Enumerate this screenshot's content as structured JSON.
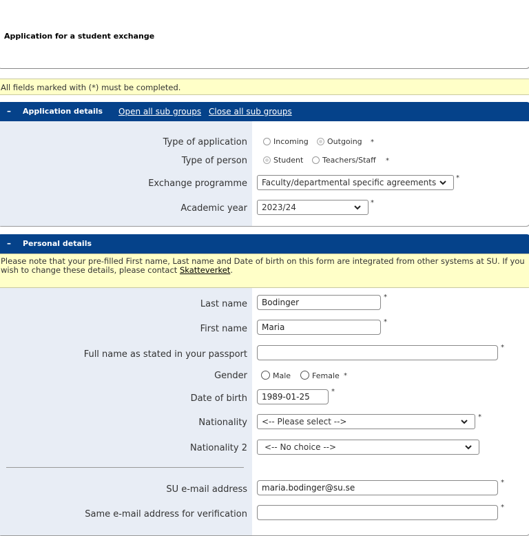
{
  "page": {
    "title": "Application for a student exchange"
  },
  "notice_required": "All fields marked with (*) must be completed.",
  "application": {
    "header": "Application details",
    "open_all": "Open all sub groups",
    "close_all": "Close all sub groups",
    "type_of_application": {
      "label": "Type of application",
      "options": [
        "Incoming",
        "Outgoing"
      ],
      "selected": "Outgoing"
    },
    "type_of_person": {
      "label": "Type of person",
      "options": [
        "Student",
        "Teachers/Staff"
      ],
      "selected": "Student"
    },
    "exchange_programme": {
      "label": "Exchange programme",
      "value": "Faculty/departmental specific agreements"
    },
    "academic_year": {
      "label": "Academic year",
      "value": "2023/24"
    }
  },
  "personal": {
    "header": "Personal details",
    "notice_text": "Please note that your pre-filled First name, Last name and Date of birth on this form are integrated from other systems at SU. If you wish to change these details, please contact ",
    "notice_link": "Skatteverket",
    "notice_end": ".",
    "last_name": {
      "label": "Last name",
      "value": "Bodinger"
    },
    "first_name": {
      "label": "First name",
      "value": "Maria"
    },
    "passport_name": {
      "label": "Full name as stated in your passport",
      "value": ""
    },
    "gender": {
      "label": "Gender",
      "options": [
        "Male",
        "Female"
      ]
    },
    "dob": {
      "label": "Date of birth",
      "value": "1989-01-25"
    },
    "nationality": {
      "label": "Nationality",
      "value": "<-- Please select -->"
    },
    "nationality2": {
      "label": "Nationality 2",
      "value": "<-- No choice -->"
    },
    "su_email": {
      "label": "SU e-mail address",
      "value": "maria.bodinger@su.se"
    },
    "email_verify": {
      "label": "Same e-mail address for verification",
      "value": ""
    }
  },
  "required_marker": "*",
  "collapse_symbol": "–"
}
